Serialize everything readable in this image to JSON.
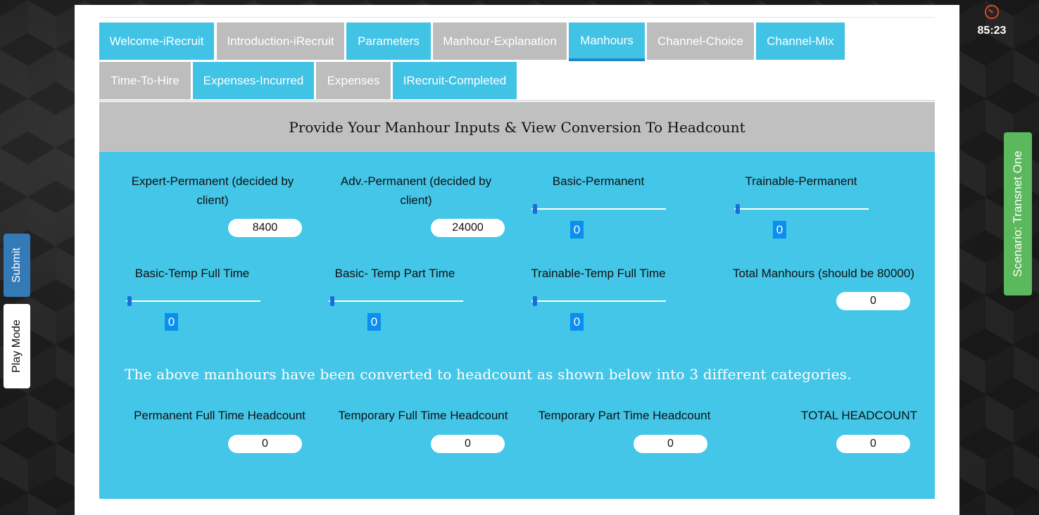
{
  "tabs": [
    {
      "label": "Welcome-iRecruit",
      "style": "blue"
    },
    {
      "label": "Introduction-iRecruit",
      "style": "grey"
    },
    {
      "label": "Parameters",
      "style": "blue"
    },
    {
      "label": "Manhour-Explanation",
      "style": "grey"
    },
    {
      "label": "Manhours",
      "style": "blue",
      "active": true
    },
    {
      "label": "Channel-Choice",
      "style": "grey"
    },
    {
      "label": "Channel-Mix",
      "style": "blue"
    },
    {
      "label": "Time-To-Hire",
      "style": "grey"
    },
    {
      "label": "Expenses-Incurred",
      "style": "blue"
    },
    {
      "label": "Expenses",
      "style": "grey"
    },
    {
      "label": "IRecruit-Completed",
      "style": "blue"
    }
  ],
  "header": {
    "title": "Provide Your Manhour Inputs & View Conversion To Headcount"
  },
  "fields": {
    "expert_perm": {
      "label": "Expert-Permanent (decided by client)",
      "value": "8400"
    },
    "adv_perm": {
      "label": "Adv.-Permanent (decided by client)",
      "value": "24000"
    },
    "basic_perm": {
      "label": "Basic-Permanent",
      "value": "0"
    },
    "trainable_perm": {
      "label": "Trainable-Permanent",
      "value": "0"
    },
    "basic_temp_ft": {
      "label": "Basic-Temp Full Time",
      "value": "0"
    },
    "basic_temp_pt": {
      "label": "Basic- Temp Part Time",
      "value": "0"
    },
    "trainable_temp_ft": {
      "label": "Trainable-Temp Full Time",
      "value": "0"
    },
    "total_manhours": {
      "label": "Total Manhours (should be 80000)",
      "value": "0"
    }
  },
  "conversion_note": "The above manhours have been converted to headcount as shown below into 3 different categories.",
  "headcount": {
    "perm_ft": {
      "label": "Permanent Full Time Headcount",
      "value": "0"
    },
    "temp_ft": {
      "label": "Temporary Full Time Headcount",
      "value": "0"
    },
    "temp_pt": {
      "label": "Temporary Part Time Headcount",
      "value": "0"
    },
    "total": {
      "label": "TOTAL HEADCOUNT",
      "value": "0"
    }
  },
  "sidebar": {
    "submit": "Submit",
    "play_mode": "Play Mode"
  },
  "scenario": "Scenario: Transnet One",
  "timer": "85:23",
  "colors": {
    "accent_blue": "#41c3e6",
    "tab_grey": "#bdbdbd",
    "scenario_green": "#5cb85c",
    "submit_blue": "#337ab7"
  }
}
